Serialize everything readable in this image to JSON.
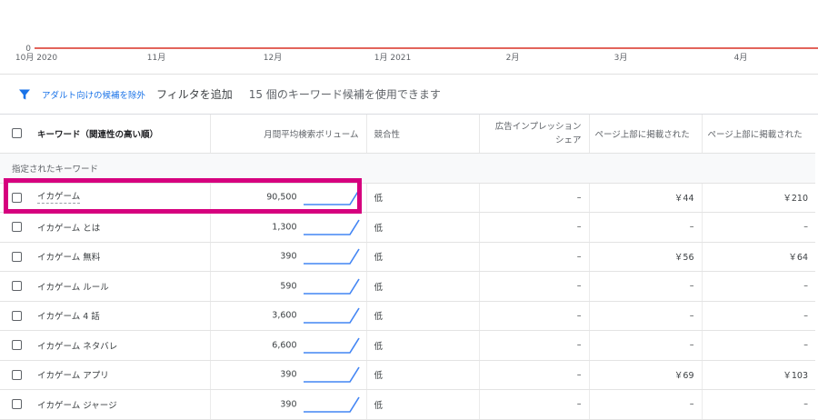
{
  "chart": {
    "y_zero_label": "0",
    "x_labels": [
      "10月 2020",
      "11月",
      "12月",
      "1月 2021",
      "2月",
      "3月",
      "4月"
    ],
    "line_color": "#d93025",
    "baseline_value": 0
  },
  "filter_bar": {
    "icon": "filter-icon",
    "adult_filter_label": "アダルト向けの候補を除外",
    "add_filter_label": "フィルタを追加",
    "candidate_count_text": "15 個のキーワード候補を使用できます"
  },
  "table": {
    "headers": {
      "keyword": "キーワード（関連性の高い順）",
      "volume": "月間平均検索ボリューム",
      "competition": "競合性",
      "impression_share_line1": "広告インプレッション",
      "impression_share_line2": "シェア",
      "top_bid_low": "ページ上部に掲載された",
      "top_bid_high": "ページ上部に掲載された"
    },
    "section_label": "指定されたキーワード",
    "rows": [
      {
        "keyword": "イカゲーム",
        "volume": "90,500",
        "competition": "低",
        "impression_share": "–",
        "bid_low": "￥44",
        "bid_high": "￥210"
      },
      {
        "keyword": "イカゲーム とは",
        "volume": "1,300",
        "competition": "低",
        "impression_share": "–",
        "bid_low": "–",
        "bid_high": "–"
      },
      {
        "keyword": "イカゲーム 無料",
        "volume": "390",
        "competition": "低",
        "impression_share": "–",
        "bid_low": "￥56",
        "bid_high": "￥64"
      },
      {
        "keyword": "イカゲーム ルール",
        "volume": "590",
        "competition": "低",
        "impression_share": "–",
        "bid_low": "–",
        "bid_high": "–"
      },
      {
        "keyword": "イカゲーム 4 話",
        "volume": "3,600",
        "competition": "低",
        "impression_share": "–",
        "bid_low": "–",
        "bid_high": "–"
      },
      {
        "keyword": "イカゲーム ネタバレ",
        "volume": "6,600",
        "competition": "低",
        "impression_share": "–",
        "bid_low": "–",
        "bid_high": "–"
      },
      {
        "keyword": "イカゲーム アプリ",
        "volume": "390",
        "competition": "低",
        "impression_share": "–",
        "bid_low": "￥69",
        "bid_high": "￥103"
      },
      {
        "keyword": "イカゲーム ジャージ",
        "volume": "390",
        "competition": "低",
        "impression_share": "–",
        "bid_low": "–",
        "bid_high": "–"
      }
    ]
  },
  "colors": {
    "accent": "#1a73e8",
    "highlight": "#d6007e",
    "sparkline": "#4285f4"
  }
}
